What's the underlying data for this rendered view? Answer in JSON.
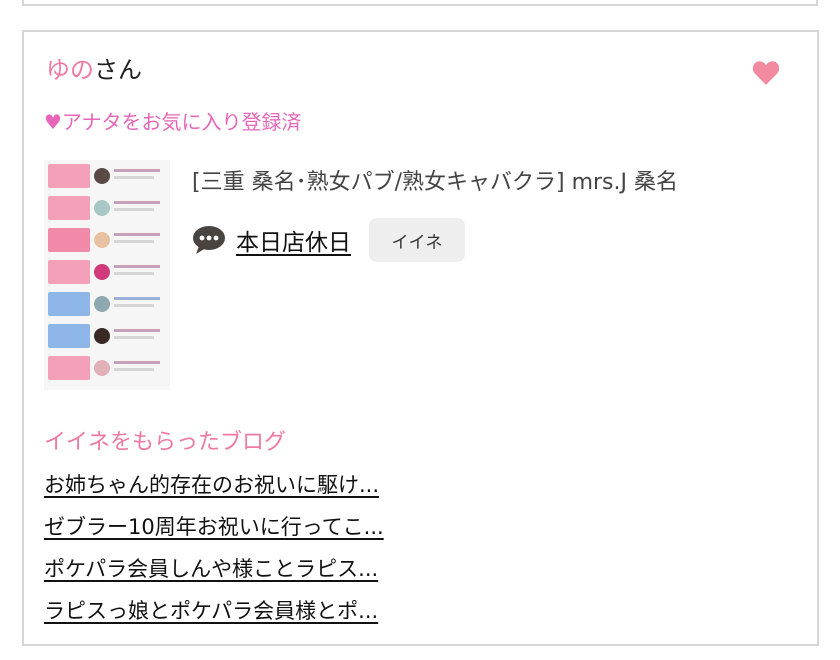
{
  "user": {
    "name": "ゆの",
    "suffix": "さん"
  },
  "favorite": {
    "status_text": "♥アナタをお気に入り登録済"
  },
  "shop": {
    "title": "[三重 桑名･熟女パブ/熟女キャバクラ]  mrs.J 桑名"
  },
  "status": {
    "text": "本日店休日",
    "like_button": "イイネ"
  },
  "blogs": {
    "heading": "イイネをもらったブログ",
    "items": [
      "お姉ちゃん的存在のお祝いに駆け...",
      "ゼブラー10周年お祝いに行ってこ...",
      "ポケパラ会員しんや様ことラピス...",
      "ラピスっ娘とポケパラ会員様とポ..."
    ]
  },
  "colors": {
    "pink": "#f07aa6",
    "magenta": "#e766b8",
    "heart": "#f28aa0",
    "border": "#d6d6d6",
    "button_bg": "#eeeeee"
  },
  "icons": {
    "heart": "heart-icon",
    "chat": "chat-bubble-icon"
  }
}
